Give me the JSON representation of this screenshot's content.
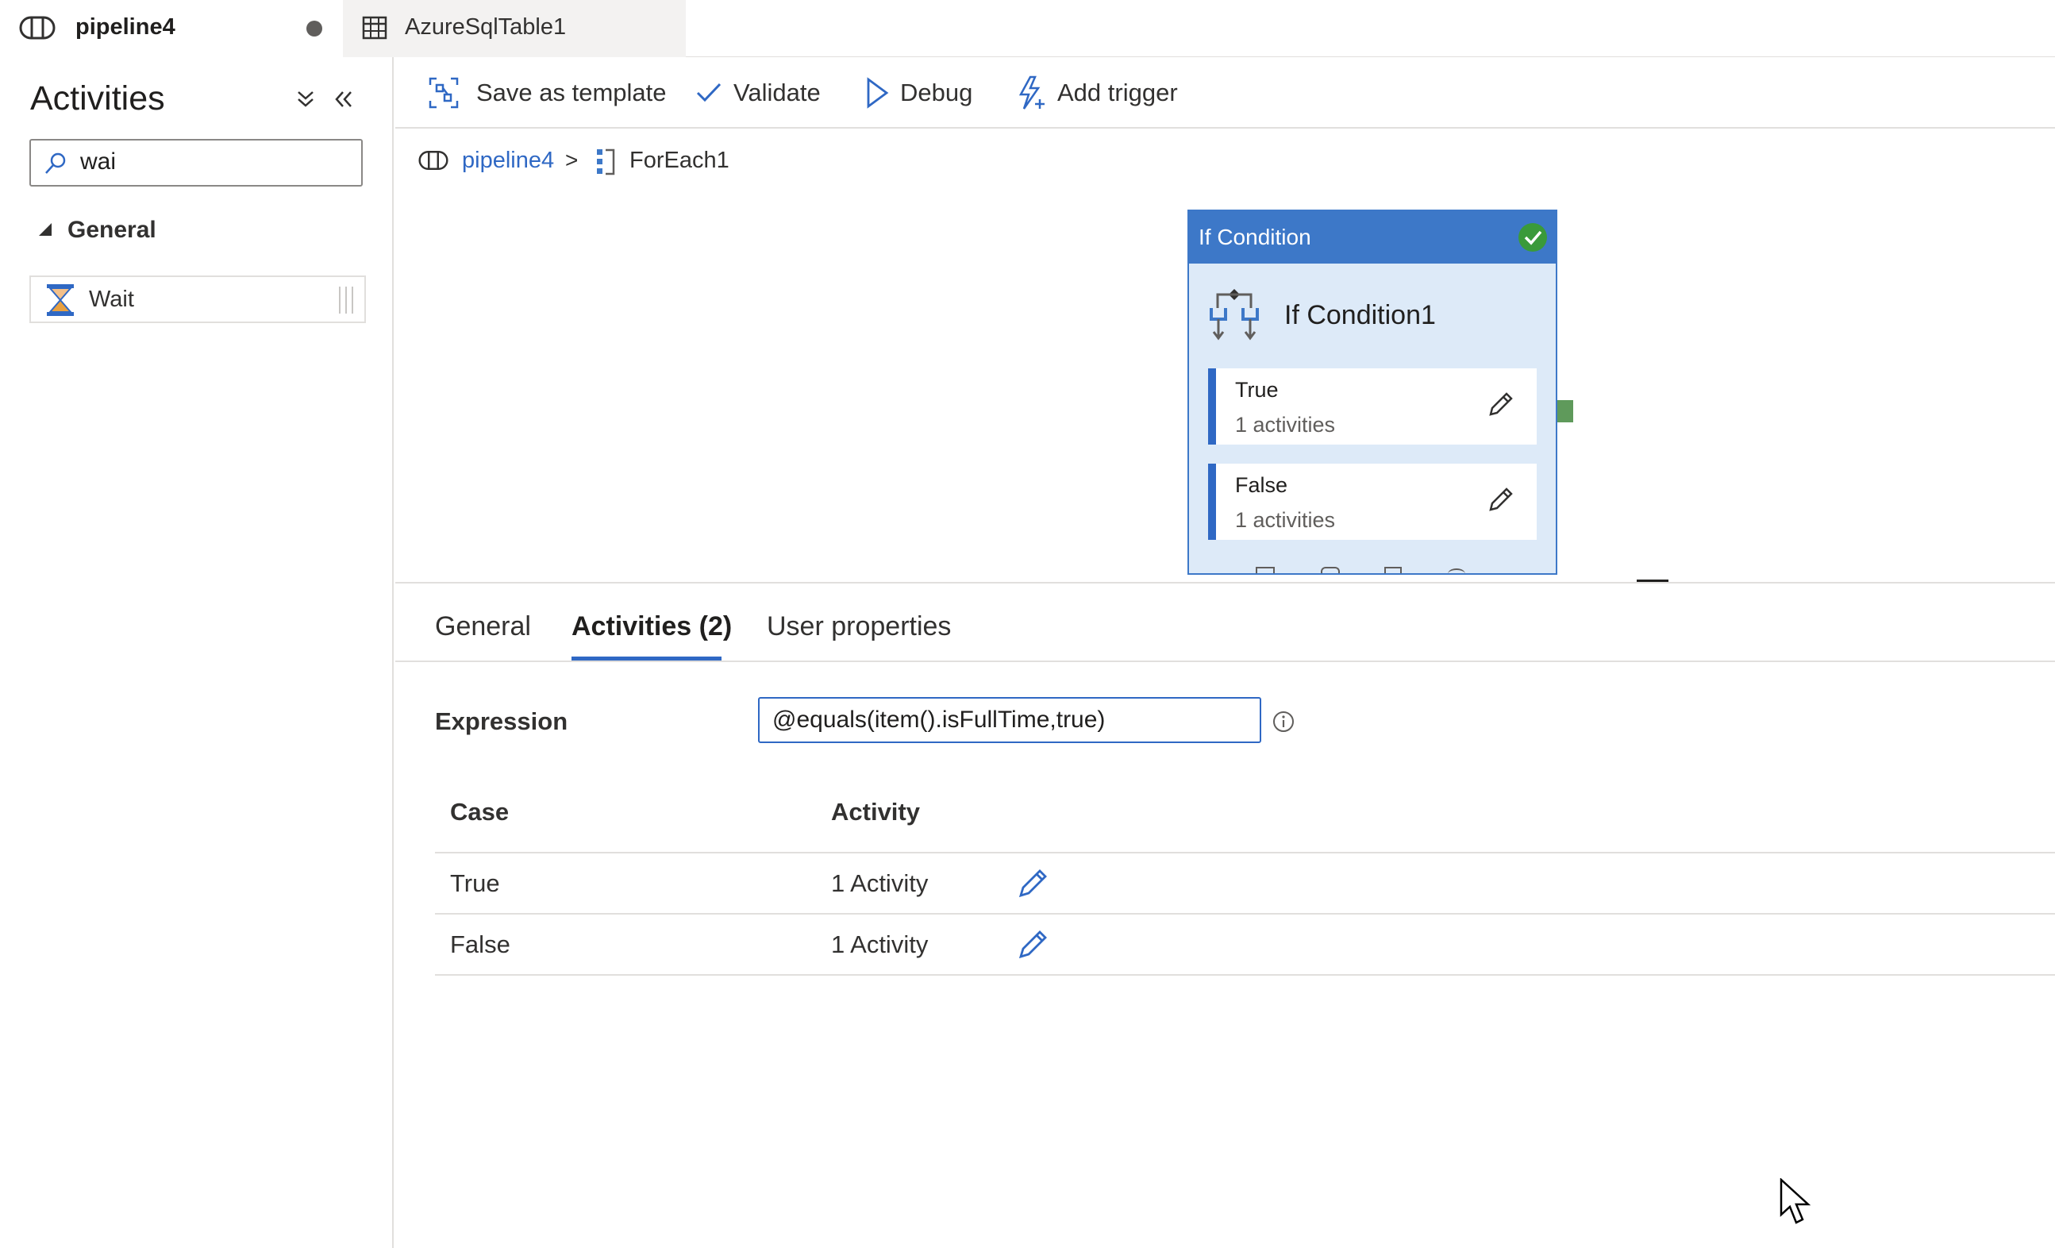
{
  "tabs": [
    {
      "label": "pipeline4",
      "icon": "pipeline-icon",
      "unsaved": true
    },
    {
      "label": "AzureSqlTable1",
      "icon": "table-icon"
    }
  ],
  "sidebar": {
    "title": "Activities",
    "search_value": "wai",
    "group_label": "General",
    "items": [
      {
        "label": "Wait",
        "icon": "hourglass-icon"
      }
    ]
  },
  "toolbar": {
    "save_template": "Save as template",
    "validate": "Validate",
    "debug": "Debug",
    "add_trigger": "Add trigger"
  },
  "breadcrumb": {
    "pipeline": "pipeline4",
    "separator": ">",
    "current": "ForEach1"
  },
  "canvas": {
    "card_header": "If Condition",
    "card_name": "If Condition1",
    "branches": [
      {
        "name": "True",
        "count": "1 activities"
      },
      {
        "name": "False",
        "count": "1 activities"
      }
    ]
  },
  "panel": {
    "tabs": [
      "General",
      "Activities (2)",
      "User properties"
    ],
    "active_tab": "Activities (2)",
    "expression_label": "Expression",
    "expression_value": "@equals(item().isFullTime,true)",
    "table": {
      "headers": [
        "Case",
        "Activity"
      ],
      "rows": [
        {
          "case": "True",
          "activity": "1 Activity"
        },
        {
          "case": "False",
          "activity": "1 Activity"
        }
      ]
    }
  },
  "colors": {
    "accent": "#2f68c4",
    "card_header": "#3d78c8",
    "card_bg": "#ddeaf8",
    "success": "#3a9a3a",
    "output_port": "#5f9a5b"
  }
}
